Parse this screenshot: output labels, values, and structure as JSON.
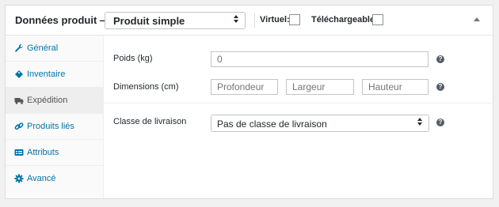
{
  "header": {
    "title": "Données produit —",
    "product_type": "Produit simple",
    "virtual_label": "Virtuel:",
    "downloadable_label": "Téléchargeable:"
  },
  "tabs": [
    {
      "label": "Général",
      "icon": "wrench-icon",
      "active": false
    },
    {
      "label": "Inventaire",
      "icon": "tag-icon",
      "active": false
    },
    {
      "label": "Expédition",
      "icon": "truck-icon",
      "active": true
    },
    {
      "label": "Produits liés",
      "icon": "link-icon",
      "active": false
    },
    {
      "label": "Attributs",
      "icon": "list-card-icon",
      "active": false
    },
    {
      "label": "Avancé",
      "icon": "gear-icon",
      "active": false
    }
  ],
  "shipping": {
    "weight_label": "Poids (kg)",
    "weight_placeholder": "0",
    "dimensions_label": "Dimensions (cm)",
    "length_placeholder": "Profondeur",
    "width_placeholder": "Largeur",
    "height_placeholder": "Hauteur",
    "class_label": "Classe de livraison",
    "class_value": "Pas de classe de livraison"
  },
  "colors": {
    "link": "#0073aa",
    "active_tab_bg": "#eeeeee",
    "border": "#dcdcde"
  }
}
